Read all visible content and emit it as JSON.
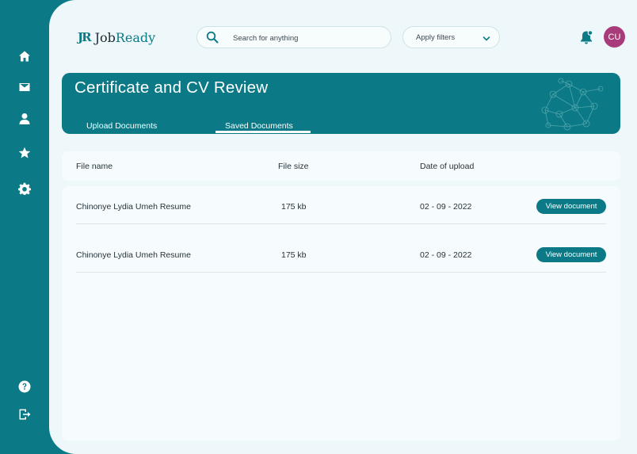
{
  "sidebar": {
    "items": [
      {
        "icon": "home-icon"
      },
      {
        "icon": "mail-icon"
      },
      {
        "icon": "user-icon"
      },
      {
        "icon": "star-icon"
      },
      {
        "icon": "settings-gear-icon"
      }
    ],
    "bottom": [
      {
        "icon": "help-icon"
      },
      {
        "icon": "logout-icon"
      }
    ]
  },
  "header": {
    "logo_mark": "JR",
    "logo_text_1": "Job",
    "logo_text_2": "Ready",
    "search_placeholder": "Search for anything",
    "filters_label": "Apply filters",
    "avatar_initials": "CU"
  },
  "banner": {
    "title": "Certificate and CV Review",
    "tabs": [
      {
        "label": "Upload Documents"
      },
      {
        "label": "Saved Documents",
        "active": true
      }
    ]
  },
  "table": {
    "headers": [
      "File name",
      "File size",
      "Date of upload"
    ],
    "rows": [
      {
        "name": "Chinonye Lydia Umeh Resume",
        "size": "175 kb",
        "date": "02 - 09 - 2022",
        "action": "View document"
      },
      {
        "name": "Chinonye Lydia Umeh Resume",
        "size": "175 kb",
        "date": "02 - 09 - 2022",
        "action": "View document"
      }
    ]
  },
  "colors": {
    "primary": "#0b7a86",
    "background": "#eef8fa",
    "avatar": "#a83c7a"
  }
}
